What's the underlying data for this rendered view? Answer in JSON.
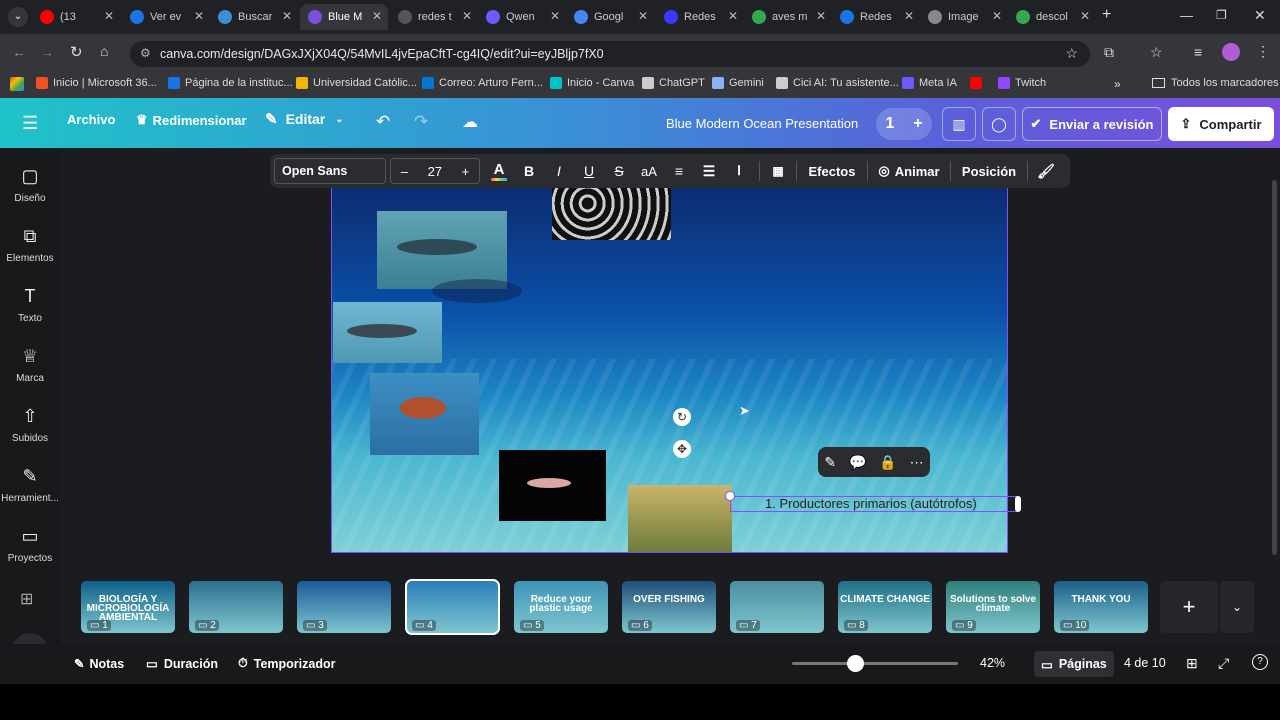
{
  "browser": {
    "tabs": [
      {
        "label": "(13",
        "color": "#ff0000"
      },
      {
        "label": "Ver ev",
        "color": "#1a73e8"
      },
      {
        "label": "Buscar",
        "color": "#3a8fd6"
      },
      {
        "label": "Blue M",
        "color": "#7a4fdc"
      },
      {
        "label": "redes t",
        "color": "#555555"
      },
      {
        "label": "Qwen",
        "color": "#6b5bff"
      },
      {
        "label": "Googl",
        "color": "#4285f4"
      },
      {
        "label": "Redes",
        "color": "#3a3aff"
      },
      {
        "label": "aves m",
        "color": "#34a853"
      },
      {
        "label": "Redes",
        "color": "#1a73e8"
      },
      {
        "label": "Image",
        "color": "#888888"
      },
      {
        "label": "descol",
        "color": "#34a853"
      }
    ],
    "url": "canva.com/design/DAGxJXjX04Q/54MvIL4jvEpaCftT-cg4IQ/edit?ui=eyJBljp7fX0",
    "bookmarks": [
      {
        "label": "Inicio | Microsoft 36...",
        "color": "#f25022"
      },
      {
        "label": "Página de la instituc...",
        "color": "#1a73e8"
      },
      {
        "label": "Universidad Católic...",
        "color": "#f4b400"
      },
      {
        "label": "Correo: Arturo Fern...",
        "color": "#0078d4"
      },
      {
        "label": "Inicio - Canva",
        "color": "#00c4cc"
      },
      {
        "label": "ChatGPT",
        "color": "#cccccc"
      },
      {
        "label": "Gemini",
        "color": "#8ab4f8"
      },
      {
        "label": "Cici AI: Tu asistente...",
        "color": "#cccccc"
      },
      {
        "label": "Meta IA",
        "color": "#6b5bff"
      },
      {
        "label": "",
        "color": "#ff0000"
      },
      {
        "label": "Twitch",
        "color": "#9146ff"
      }
    ],
    "all_bookmarks": "Todos los marcadores"
  },
  "header": {
    "archivo": "Archivo",
    "redimensionar": "Redimensionar",
    "editar": "Editar",
    "title": "Blue Modern Ocean Presentation",
    "collaborators": "1",
    "review": "Enviar a revisión",
    "share": "Compartir"
  },
  "sidebar": {
    "items": [
      {
        "label": "Diseño",
        "icon": "layout-icon"
      },
      {
        "label": "Elementos",
        "icon": "elements-icon"
      },
      {
        "label": "Texto",
        "icon": "text-icon"
      },
      {
        "label": "Marca",
        "icon": "brand-icon"
      },
      {
        "label": "Subidos",
        "icon": "upload-icon"
      },
      {
        "label": "Herramient...",
        "icon": "tools-icon"
      },
      {
        "label": "Proyectos",
        "icon": "folder-icon"
      }
    ]
  },
  "toolbar": {
    "font": "Open Sans",
    "minus": "–",
    "size": "27",
    "plus": "+",
    "effects": "Efectos",
    "animate": "Animar",
    "position": "Posición"
  },
  "slide": {
    "text": "1. Productores primarios (autótrofos)"
  },
  "pages": [
    {
      "num": "1",
      "label": "BIOLOGÍA Y MICROBIOLOGÍA AMBIENTAL",
      "bg": "#0f5f8a"
    },
    {
      "num": "2",
      "label": "",
      "bg": "#2b6f8e"
    },
    {
      "num": "3",
      "label": "",
      "bg": "#1c5a9c"
    },
    {
      "num": "4",
      "label": "",
      "bg": "#2a7fb8"
    },
    {
      "num": "5",
      "label": "Reduce your plastic usage",
      "bg": "#3f94b5"
    },
    {
      "num": "6",
      "label": "OVER FISHING",
      "bg": "#1e4f7a"
    },
    {
      "num": "7",
      "label": "",
      "bg": "#4a8ea0"
    },
    {
      "num": "8",
      "label": "CLIMATE CHANGE",
      "bg": "#1f6f88"
    },
    {
      "num": "9",
      "label": "Solutions to solve climate",
      "bg": "#2e7f7a"
    },
    {
      "num": "10",
      "label": "THANK YOU",
      "bg": "#1b5f8a"
    }
  ],
  "footer": {
    "notes": "Notas",
    "duration": "Duración",
    "timer": "Temporizador",
    "zoom": "42%",
    "pages": "Páginas",
    "page_count": "4 de 10"
  }
}
